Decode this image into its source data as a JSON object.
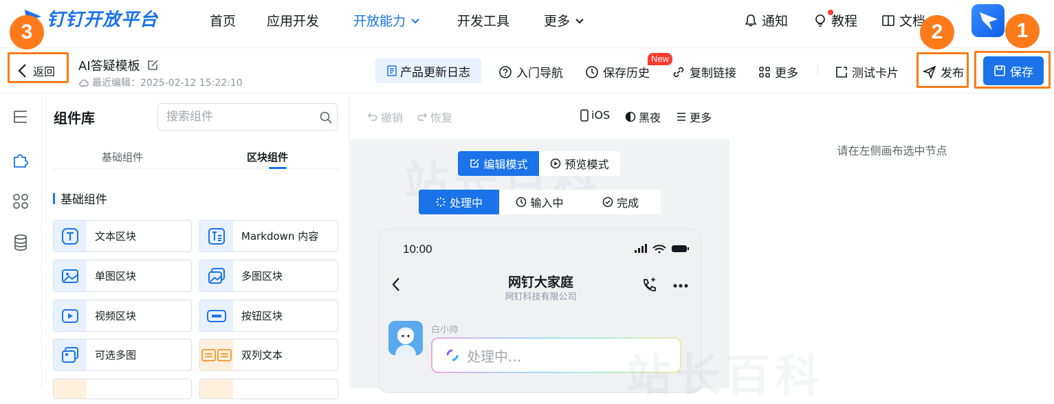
{
  "brand": {
    "name": "钉钉开放平台",
    "accent": "#1a73e8"
  },
  "nav": {
    "items": [
      {
        "label": "首页",
        "active": false
      },
      {
        "label": "应用开发",
        "active": false
      },
      {
        "label": "开放能力",
        "active": true
      },
      {
        "label": "开发工具",
        "active": false
      },
      {
        "label": "更多",
        "active": false
      }
    ],
    "notify": "通知",
    "tutorial": "教程",
    "docs": "文档"
  },
  "annotations": {
    "one": "1",
    "two": "2",
    "three": "3",
    "color": "#ff7a1a"
  },
  "toolbar": {
    "back": "返回",
    "template_name": "AI答疑模板",
    "last_edit": "最近编辑：2025-02-12 15:22:10",
    "product_log": "产品更新日志",
    "guide": "入门导航",
    "history": "保存历史",
    "new_tag": "New",
    "copy_link": "复制链接",
    "more": "更多",
    "test_card": "测试卡片",
    "publish": "发布",
    "save": "保存"
  },
  "panel": {
    "title": "组件库",
    "search_placeholder": "搜索组件",
    "tabs": [
      {
        "label": "基础组件",
        "active": false
      },
      {
        "label": "区块组件",
        "active": true
      }
    ],
    "section": "基础组件",
    "components": [
      {
        "label": "文本区块",
        "icon": "text-block-icon"
      },
      {
        "label": "Markdown 内容",
        "icon": "markdown-icon"
      },
      {
        "label": "单图区块",
        "icon": "image-icon"
      },
      {
        "label": "多图区块",
        "icon": "multi-image-icon"
      },
      {
        "label": "视频区块",
        "icon": "video-icon"
      },
      {
        "label": "按钮区块",
        "icon": "button-icon"
      },
      {
        "label": "可选多图",
        "icon": "select-image-icon"
      },
      {
        "label": "双列文本",
        "icon": "two-column-icon"
      }
    ]
  },
  "canvas": {
    "undo": "撤销",
    "redo": "恢复",
    "ios": "iOS",
    "dark": "黑夜",
    "more": "更多",
    "modes": [
      {
        "label": "编辑模式",
        "active": true
      },
      {
        "label": "预览模式",
        "active": false
      }
    ],
    "states": [
      {
        "label": "处理中",
        "active": true
      },
      {
        "label": "输入中",
        "active": false
      },
      {
        "label": "完成",
        "active": false
      }
    ],
    "phone": {
      "time": "10:00",
      "chat_title": "网钉大家庭",
      "chat_subtitle": "网钉科技有限公司",
      "sender": "白小帅",
      "message": "处理中..."
    }
  },
  "props": {
    "empty_hint": "请在左侧画布选中节点"
  }
}
